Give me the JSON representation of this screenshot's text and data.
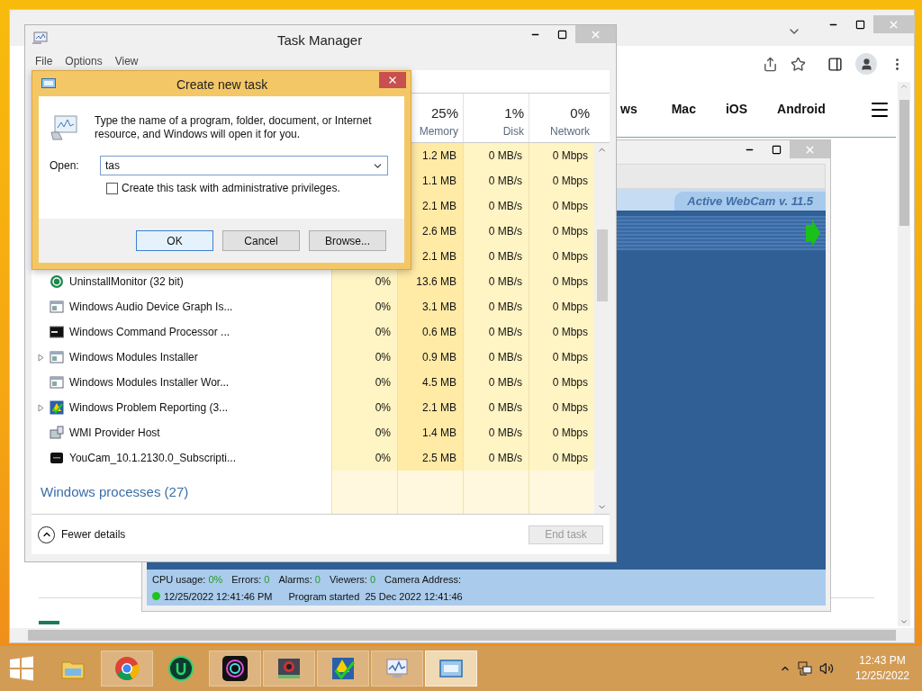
{
  "browser": {
    "nav": [
      {
        "label": "ws"
      },
      {
        "label": "Mac"
      },
      {
        "label": "iOS"
      },
      {
        "label": "Android"
      }
    ]
  },
  "webcam": {
    "badge": "Active WebCam v. 11.5",
    "status": {
      "cpu_label": "CPU usage:",
      "cpu_value": "0%",
      "counters": [
        {
          "label": "Errors:",
          "value": "0"
        },
        {
          "label": "Alarms:",
          "value": "0"
        },
        {
          "label": "Viewers:",
          "value": "0"
        }
      ],
      "camera_label": "Camera Address:",
      "timestamp": "12/25/2022 12:41:46 PM",
      "started": "Program started  25 Dec 2022 12:41:46"
    }
  },
  "task_manager": {
    "title": "Task Manager",
    "menu": [
      "File",
      "Options",
      "View"
    ],
    "columns": [
      {
        "percent": "25%",
        "label": "Memory"
      },
      {
        "percent": "1%",
        "label": "Disk"
      },
      {
        "percent": "0%",
        "label": "Network"
      }
    ],
    "rows": [
      {
        "memory": "1.2 MB",
        "disk": "0 MB/s",
        "network": "0 Mbps"
      },
      {
        "memory": "1.1 MB",
        "disk": "0 MB/s",
        "network": "0 Mbps"
      },
      {
        "memory": "2.1 MB",
        "disk": "0 MB/s",
        "network": "0 Mbps"
      },
      {
        "memory": "2.6 MB",
        "disk": "0 MB/s",
        "network": "0 Mbps"
      },
      {
        "memory": "2.1 MB",
        "disk": "0 MB/s",
        "network": "0 Mbps"
      },
      {
        "kind": "green-circle",
        "name": "UninstallMonitor (32 bit)",
        "expandable": false,
        "cpu": "0%",
        "memory": "13.6 MB",
        "disk": "0 MB/s",
        "network": "0 Mbps"
      },
      {
        "kind": "app",
        "name": "Windows Audio Device Graph Is...",
        "expandable": false,
        "cpu": "0%",
        "memory": "3.1 MB",
        "disk": "0 MB/s",
        "network": "0 Mbps"
      },
      {
        "kind": "console",
        "name": "Windows Command Processor ...",
        "expandable": false,
        "cpu": "0%",
        "memory": "0.6 MB",
        "disk": "0 MB/s",
        "network": "0 Mbps"
      },
      {
        "kind": "app",
        "name": "Windows Modules Installer",
        "expandable": true,
        "cpu": "0%",
        "memory": "0.9 MB",
        "disk": "0 MB/s",
        "network": "0 Mbps"
      },
      {
        "kind": "app",
        "name": "Windows Modules Installer Wor...",
        "expandable": false,
        "cpu": "0%",
        "memory": "4.5 MB",
        "disk": "0 MB/s",
        "network": "0 Mbps"
      },
      {
        "kind": "shield",
        "name": "Windows Problem Reporting (3...",
        "expandable": true,
        "cpu": "0%",
        "memory": "2.1 MB",
        "disk": "0 MB/s",
        "network": "0 Mbps"
      },
      {
        "kind": "server",
        "name": "WMI Provider Host",
        "expandable": false,
        "cpu": "0%",
        "memory": "1.4 MB",
        "disk": "0 MB/s",
        "network": "0 Mbps"
      },
      {
        "kind": "dark",
        "name": "YouCam_10.1.2130.0_Subscripti...",
        "expandable": false,
        "cpu": "0%",
        "memory": "2.5 MB",
        "disk": "0 MB/s",
        "network": "0 Mbps"
      }
    ],
    "group": "Windows processes (27)",
    "fewer_details": "Fewer details",
    "end_task": {
      "label": "End task",
      "disabled": true
    }
  },
  "dialog": {
    "title": "Create new task",
    "message": "Type the name of a program, folder, document, or Internet resource, and Windows will open it for you.",
    "open_label": "Open:",
    "open_value": "tas",
    "admin": {
      "label": "Create this task with administrative privileges.",
      "checked": false
    },
    "buttons": [
      {
        "label": "OK",
        "default": true
      },
      {
        "label": "Cancel",
        "default": false
      },
      {
        "label": "Browse...",
        "default": false
      }
    ]
  },
  "taskbar": {
    "apps": [
      {
        "kind": "explorer",
        "running": false,
        "active": false
      },
      {
        "kind": "chrome",
        "running": true,
        "active": false
      },
      {
        "kind": "u-circle",
        "running": false,
        "active": false
      },
      {
        "kind": "lens",
        "running": true,
        "active": false
      },
      {
        "kind": "webcam",
        "running": true,
        "active": false
      },
      {
        "kind": "shield",
        "running": true,
        "active": false
      },
      {
        "kind": "monitor",
        "running": true,
        "active": false
      },
      {
        "kind": "window",
        "running": true,
        "active": true
      }
    ],
    "time": "12:43 PM",
    "date": "12/25/2022"
  }
}
